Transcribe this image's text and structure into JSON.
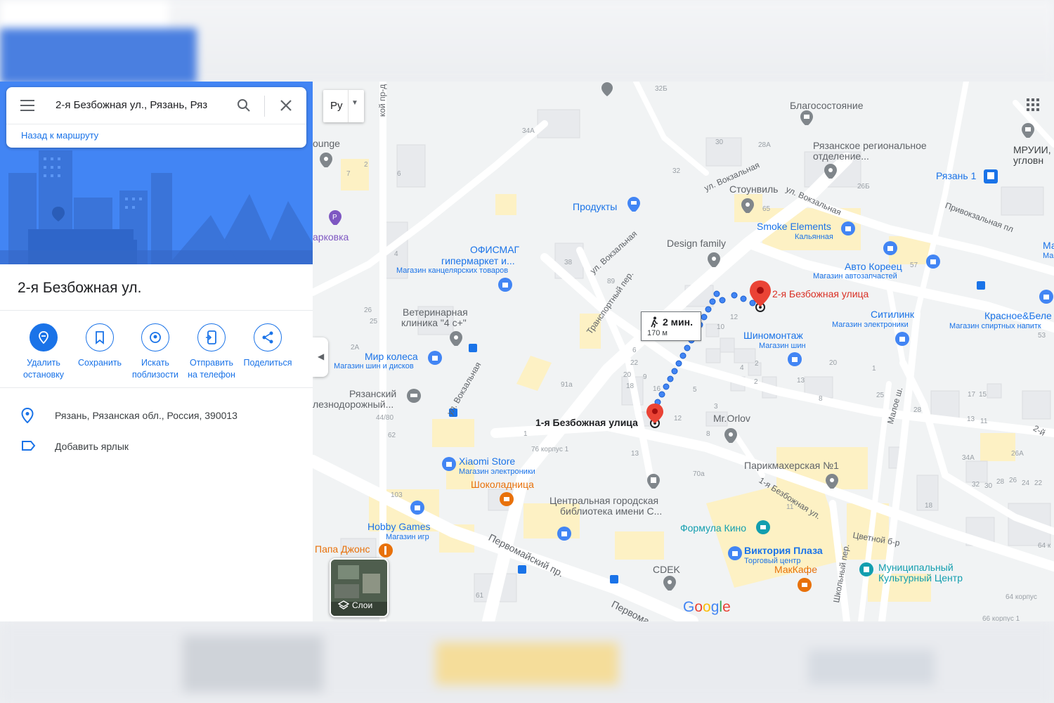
{
  "search": {
    "query": "2-я Безбожная ул., Рязань, Ряз",
    "back_link": "Назад к маршруту"
  },
  "place": {
    "title": "2-я Безбожная ул.",
    "address": "Рязань, Рязанская обл., Россия, 390013",
    "add_label": "Добавить ярлык"
  },
  "actions": [
    {
      "l1": "Удалить",
      "l2": "остановку",
      "icon": "remove-stop-icon"
    },
    {
      "l1": "Сохранить",
      "l2": "",
      "icon": "bookmark-icon"
    },
    {
      "l1": "Искать",
      "l2": "поблизости",
      "icon": "nearby-icon"
    },
    {
      "l1": "Отправить",
      "l2": "на телефон",
      "icon": "send-to-phone-icon"
    },
    {
      "l1": "Поделиться",
      "l2": "",
      "icon": "share-icon"
    }
  ],
  "map": {
    "lang": "Ру",
    "layers": "Слои",
    "logo": "Google",
    "route": {
      "time": "2 мин.",
      "distance": "170 м"
    },
    "dest_label": "2-я Безбожная улица",
    "origin_label": "1-я Безбожная улица",
    "pois": {
      "blago": "Благосостояние",
      "ryaz_otd1": "Рязанское региональное",
      "ryaz_otd2": "отделение...",
      "mruii1": "МРУИИ,",
      "mruii2": "угловн",
      "ryazan1": "Рязань 1",
      "lounge": "ounge",
      "parkovka": "арковка",
      "produkty": "Продукты",
      "stounvil": "Стоунвиль",
      "smoke": "Smoke Elements",
      "smoke_sub": "Кальянная",
      "design": "Design family",
      "officemag1": "ОФИСМАГ",
      "officemag2": "гипермаркет и...",
      "officemag_sub": "Магазин канцелярских товаров",
      "avto": "Авто Кореец",
      "avto_sub": "Магазин автозапчастей",
      "mar1": "Мар",
      "mar2": "Мага",
      "vet1": "Ветеринарная",
      "vet2": "клиника \"4 с+\"",
      "citilink": "Ситилинк",
      "citilink_sub": "Магазин электроники",
      "krasnoe": "Красное&Беле",
      "krasnoe_sub": "Магазин спиртных напитк",
      "mir": "Мир колеса",
      "mir_sub": "Магазин шин и дисков",
      "shino": "Шиномонтаж",
      "shino_sub": "Магазин шин",
      "ryaz_zhd1": "Рязанский",
      "ryaz_zhd2": "лезнодорожный...",
      "mrorlov": "Mr.Orlov",
      "xiaomi": "Xiaomi Store",
      "xiaomi_sub": "Магазин электроники",
      "parik": "Парикмахерская №1",
      "shoko": "Шоколадница",
      "lib1": "Центральная городская",
      "lib2": "библиотека имени С...",
      "hobby": "Hobby Games",
      "hobby_sub": "Магазин игр",
      "formula": "Формула Кино",
      "papa": "Папа Джонс",
      "viktoria": "Виктория Плаза",
      "viktoria_sub": "Торговый центр",
      "mak": "МакКафе",
      "cdek": "CDEK",
      "munic1": "Муниципальный",
      "munic2": "Культурный Центр"
    },
    "roads": {
      "vokz1": "ул. Вокзальная",
      "vokz2": "ул. Вокзальная",
      "vokz3": "ул. Вокзальная",
      "vokz4": "ул. Вокзальная",
      "privokz": "Привокзальная пл",
      "transport": "Транспортный пер.",
      "pervom": "Первомайский пр.",
      "pervom2": "Первома",
      "bezb1": "1-я Безбожная ул.",
      "tsvet": "Цветной б-р",
      "shkol": "Школьный пер.",
      "maloe": "Малое ш.",
      "kiy": "кой пр-д",
      "r2i": "2-й"
    },
    "numbers": {
      "n32b": "32Б",
      "n34a": "34А",
      "n30": "30",
      "n32": "32",
      "n28a": "28А",
      "n26b": "26Б",
      "n7": "7",
      "n2": "2",
      "n6": "6",
      "n65": "65",
      "n4": "4",
      "n38": "38",
      "n89": "89",
      "n26": "26",
      "n25": "25",
      "n2a": "2А",
      "n57": "57",
      "n12": "12",
      "n10": "10",
      "n6b": "6",
      "n22": "22",
      "n20": "20",
      "n18": "18",
      "n16": "16",
      "n9": "9",
      "n5": "5",
      "n3": "3",
      "n8": "8",
      "n12b": "12",
      "n13": "13",
      "n4b": "4",
      "n2b": "2",
      "n1": "1",
      "n20b": "20",
      "n25b": "25",
      "n28": "28",
      "n17": "17",
      "n15": "15",
      "n13b": "13",
      "n11": "11",
      "n91a": "91а",
      "n44": "44/80",
      "n62": "62",
      "n1b": "1",
      "n76": "76 корпус 1",
      "n13c": "13",
      "n70a": "70а",
      "n11b": "11",
      "n18b": "18",
      "n34ab": "34А",
      "n26a": "26А",
      "n32c": "32",
      "n30b": "30",
      "n28b": "28",
      "n26c": "26",
      "n24": "24",
      "n22b": "22",
      "n53": "53",
      "n64": "64 к",
      "n103": "103",
      "n61": "61",
      "n64k": "64 корпус",
      "n66": "66 корпус 1",
      "n8b": "8",
      "n2c": "2"
    }
  },
  "colors": {
    "accent": "#1a73e8",
    "hero": "#4285f4",
    "route": "#4285f4",
    "pin": "#ea4335",
    "building": "#fdf1c4"
  }
}
